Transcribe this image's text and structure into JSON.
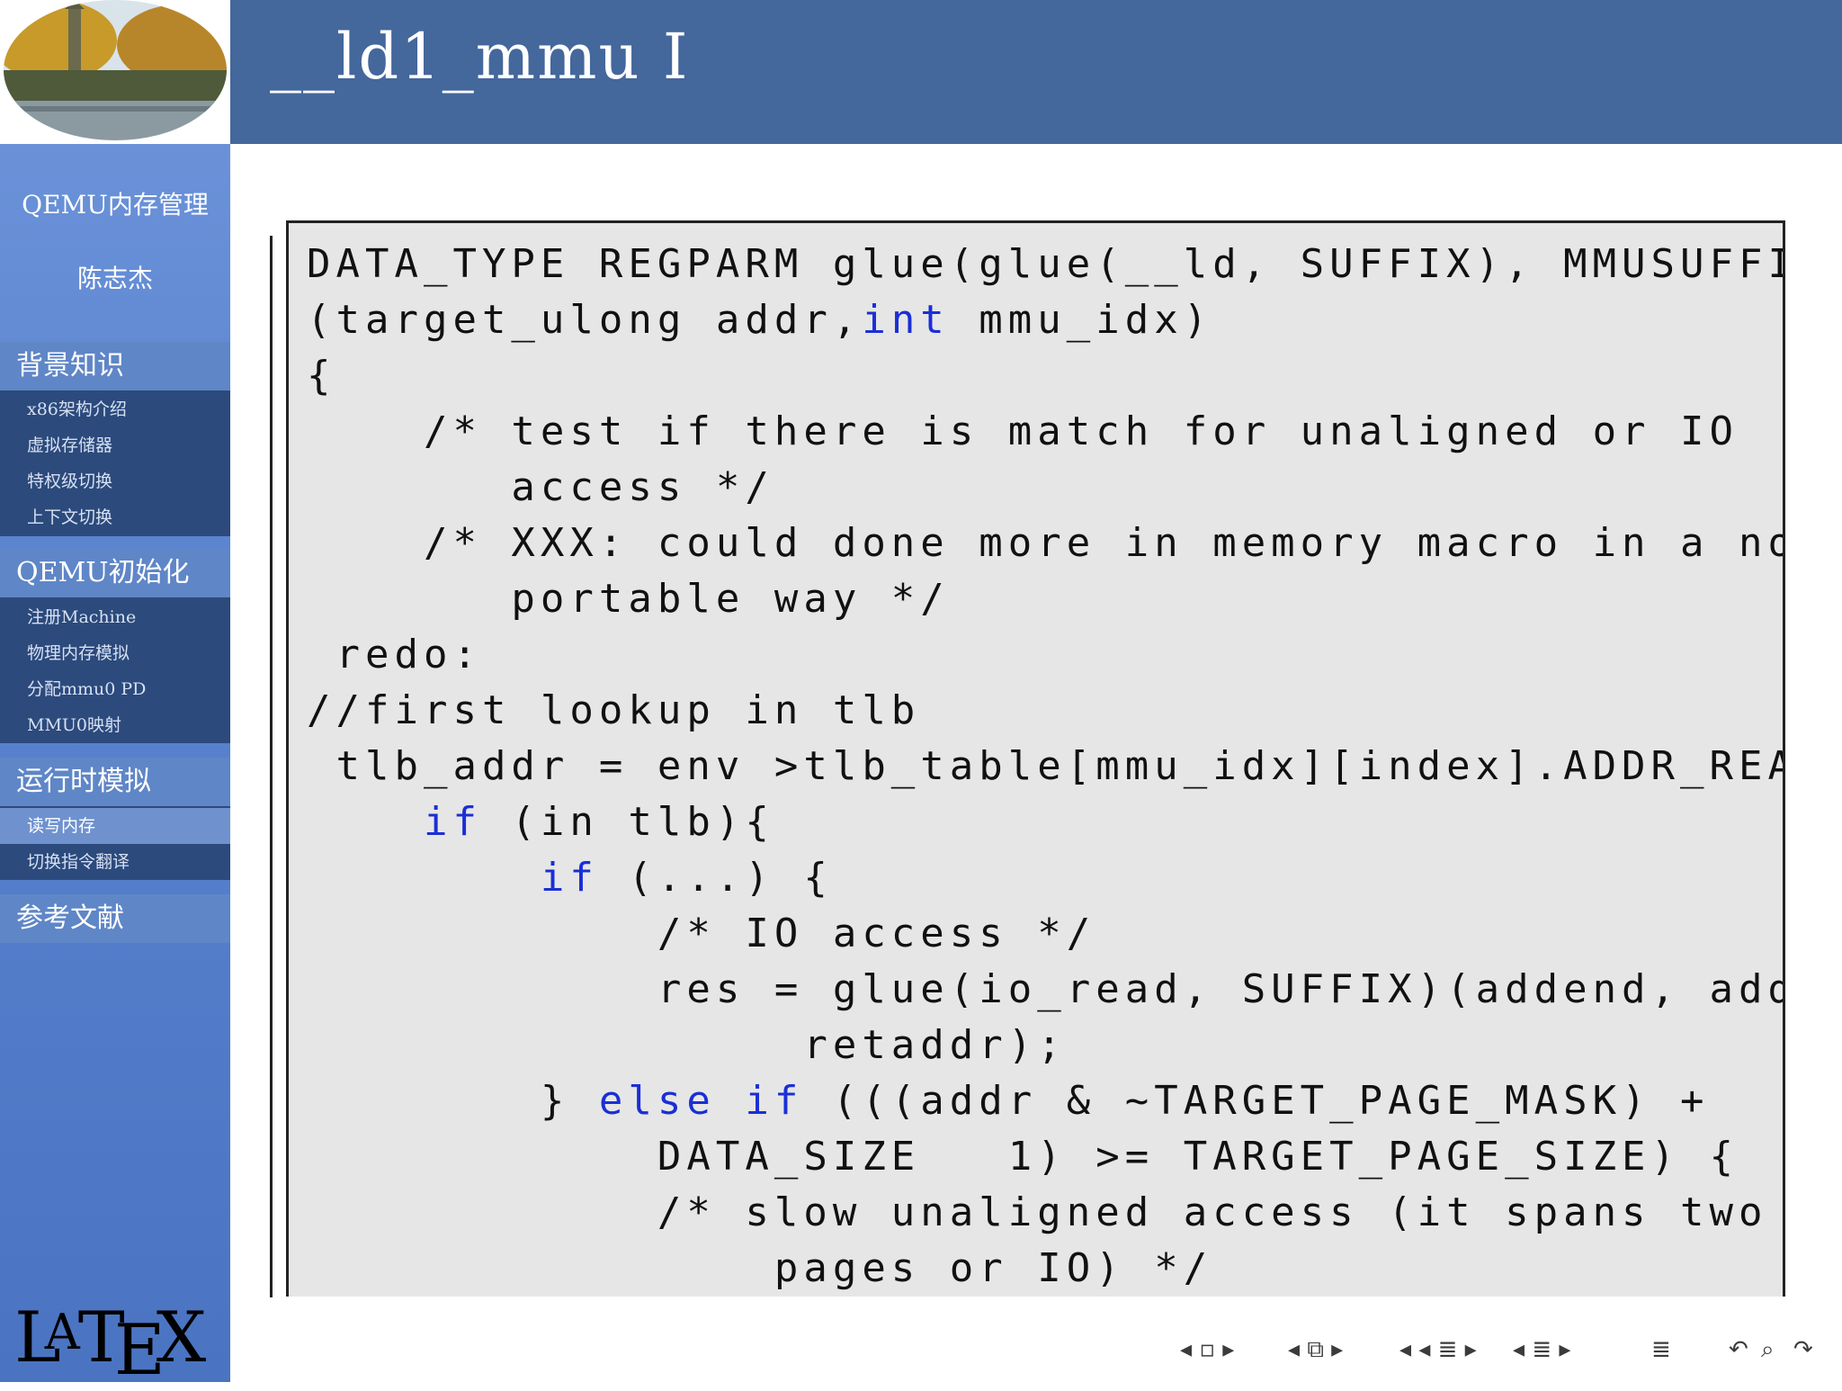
{
  "slide": {
    "title": "__ld1_mmu I"
  },
  "sidebar": {
    "talk_title": "QEMU内存管理",
    "author": "陈志杰",
    "sections": [
      {
        "label": "背景知识",
        "items": [
          "x86架构介绍",
          "虚拟存储器",
          "特权级切换",
          "上下文切换"
        ]
      },
      {
        "label": "QEMU初始化",
        "items": [
          "注册Machine",
          "物理内存模拟",
          "分配mmu0 PD",
          "MMU0映射"
        ]
      },
      {
        "label": "运行时模拟",
        "items": [
          "读写内存",
          "切换指令翻译"
        ]
      },
      {
        "label": "参考文献",
        "items": []
      }
    ],
    "active_item": "读写内存",
    "latex_logo": "LATEX"
  },
  "code": [
    "DATA_TYPE REGPARM glue(glue(__ld, SUFFIX), MMUSUFFIX)",
    "(target_ulong addr,int mmu_idx)",
    "{",
    "    /* test if there is match for unaligned or IO",
    "       access */",
    "    /* XXX: could done more in memory macro in a non",
    "       portable way */",
    " redo:",
    "//first lookup in tlb",
    " tlb_addr = env >tlb_table[mmu_idx][index].ADDR_READ;",
    "    if (in tlb){",
    "        if (...) {",
    "            /* IO access */",
    "            res = glue(io_read, SUFFIX)(addend, addr,",
    "                 retaddr);",
    "        } else if (((addr & ~TARGET_PAGE_MASK) +",
    "            DATA_SIZE   1) >= TARGET_PAGE_SIZE) {",
    "            /* slow unaligned access (it spans two",
    "                pages or IO) */"
  ],
  "nav": {
    "icons": [
      "nav-frame-icon",
      "nav-subsection-icon",
      "nav-section-icon",
      "nav-presentation-icon",
      "nav-toc-icon",
      "nav-back-icon",
      "nav-search-icon",
      "nav-forward-icon"
    ]
  },
  "colors": {
    "topbar": "#44679c",
    "sidebar": "#5b85cf",
    "code_bg": "#e6e6e6",
    "keyword": "#1a2fd6"
  }
}
